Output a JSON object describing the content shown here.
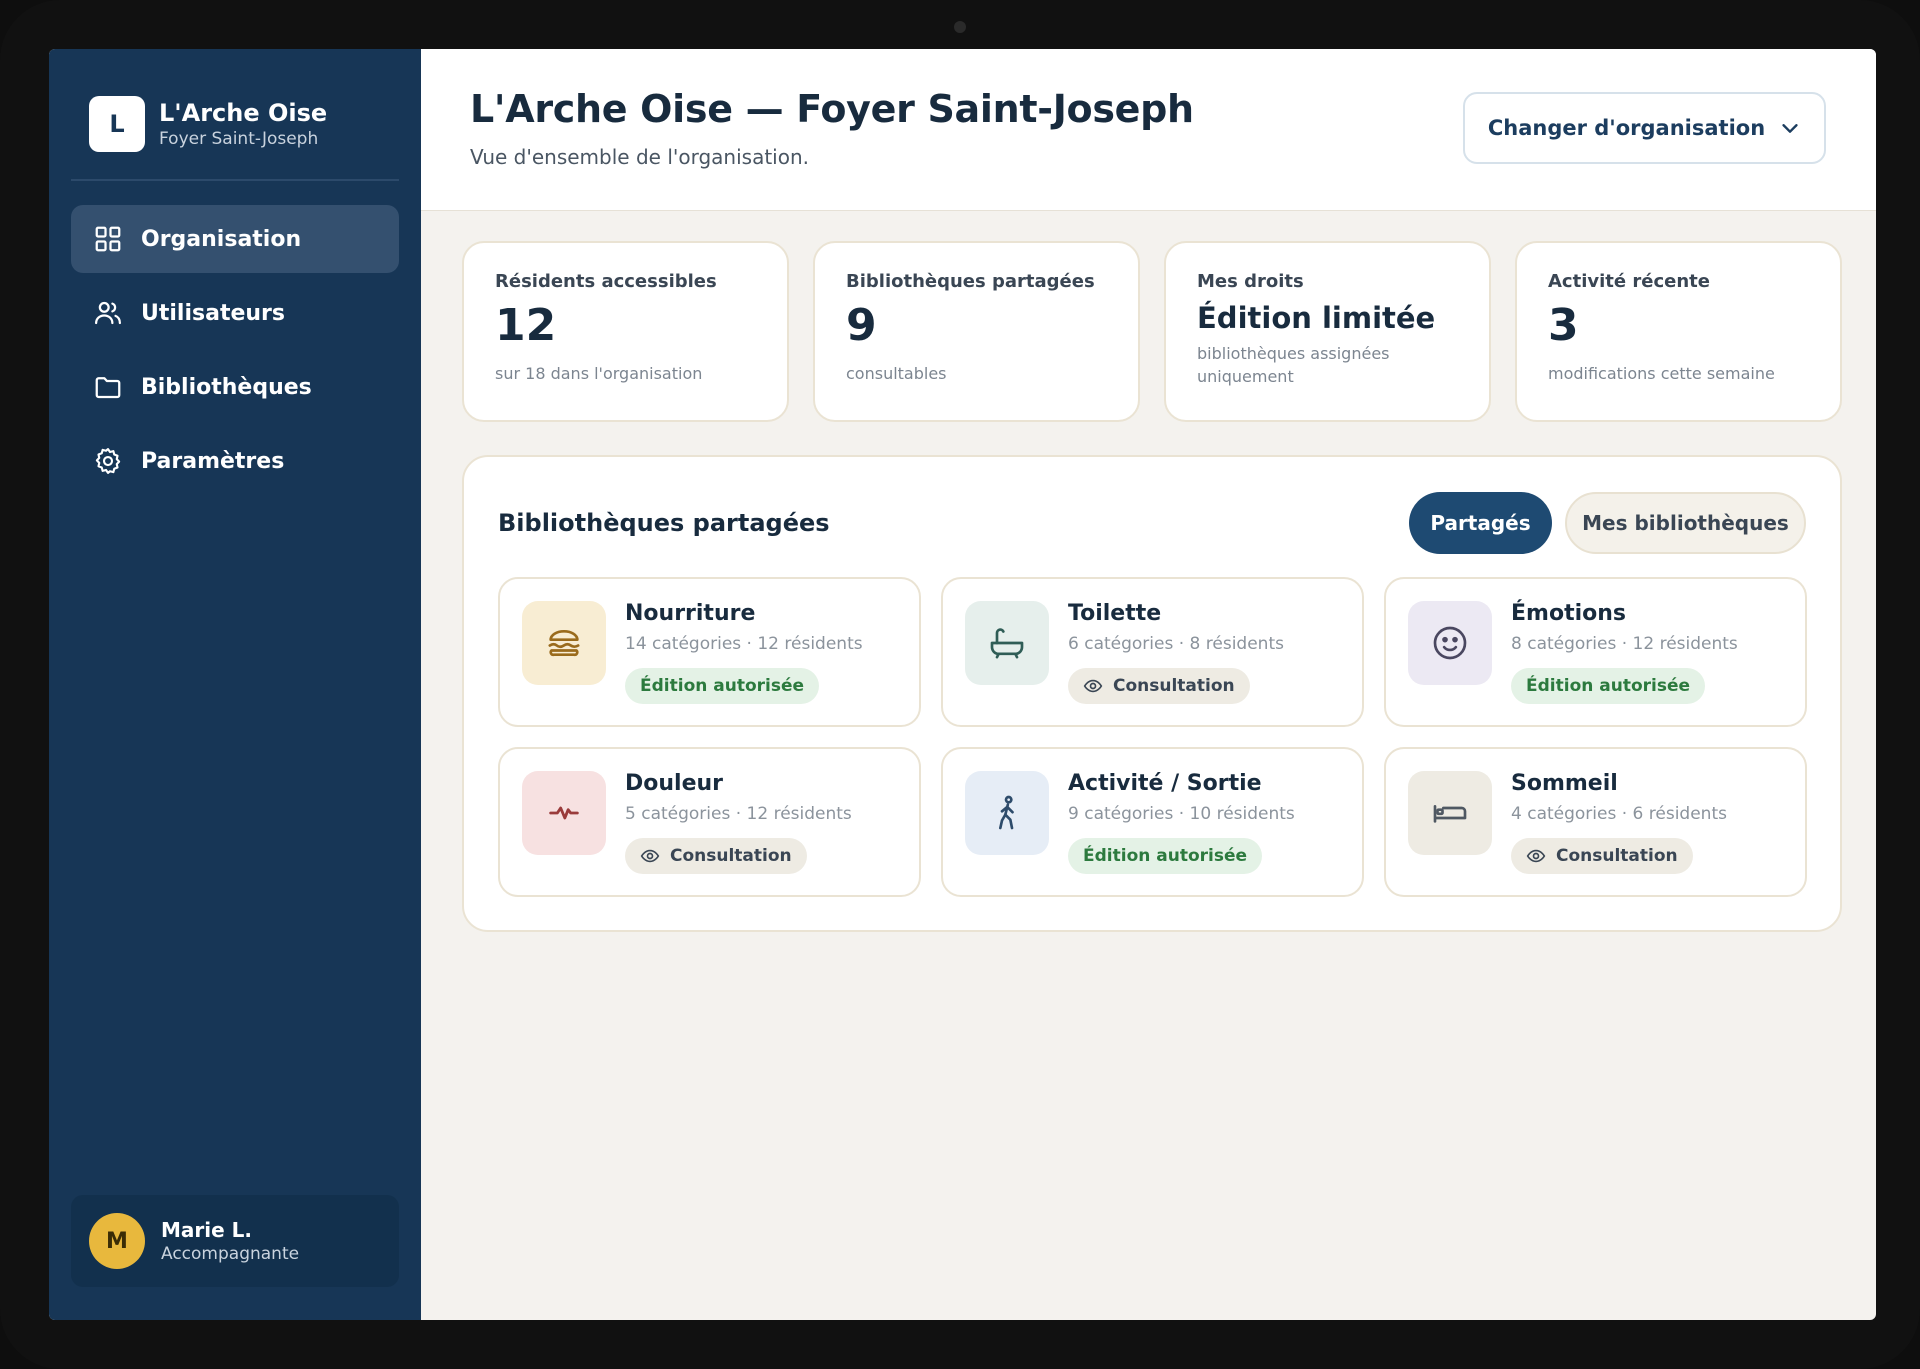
{
  "sidebar": {
    "brand": {
      "initial": "L",
      "title": "L'Arche Oise",
      "subtitle": "Foyer Saint-Joseph"
    },
    "nav": [
      {
        "label": "Organisation",
        "icon": "grid-icon",
        "active": true
      },
      {
        "label": "Utilisateurs",
        "icon": "users-icon",
        "active": false
      },
      {
        "label": "Bibliothèques",
        "icon": "folder-icon",
        "active": false
      },
      {
        "label": "Paramètres",
        "icon": "gear-icon",
        "active": false
      }
    ],
    "user": {
      "initial": "M",
      "name": "Marie L.",
      "role": "Accompagnante"
    }
  },
  "header": {
    "title": "L'Arche Oise — Foyer Saint-Joseph",
    "subtitle": "Vue d'ensemble de l'organisation.",
    "switch_label": "Changer d'organisation"
  },
  "stats": [
    {
      "label": "Résidents accessibles",
      "value": "12",
      "hint": "sur 18 dans l'organisation"
    },
    {
      "label": "Bibliothèques partagées",
      "value": "9",
      "hint": "consultables"
    },
    {
      "label": "Mes droits",
      "value": "Édition limitée",
      "hint": "bibliothèques assignées uniquement"
    },
    {
      "label": "Activité récente",
      "value": "3",
      "hint": "modifications cette semaine"
    }
  ],
  "libraries_panel": {
    "title": "Bibliothèques partagées",
    "tabs": [
      {
        "label": "Partagés",
        "active": true
      },
      {
        "label": "Mes bibliothèques",
        "active": false
      }
    ],
    "items": [
      {
        "name": "Nourriture",
        "meta": "14 catégories · 12 résidents",
        "access": "Édition autorisée",
        "access_type": "edit",
        "icon": "burger-icon",
        "icon_bg": "#f8edd3",
        "icon_color": "#9a6b1c"
      },
      {
        "name": "Toilette",
        "meta": "6 catégories · 8 résidents",
        "access": "Consultation",
        "access_type": "view",
        "icon": "bathtub-icon",
        "icon_bg": "#e6efec",
        "icon_color": "#2f5d56"
      },
      {
        "name": "Émotions",
        "meta": "8 catégories · 12 résidents",
        "access": "Édition autorisée",
        "access_type": "edit",
        "icon": "smiley-icon",
        "icon_bg": "#ece9f3",
        "icon_color": "#4a4760"
      },
      {
        "name": "Douleur",
        "meta": "5 catégories · 12 résidents",
        "access": "Consultation",
        "access_type": "view",
        "icon": "pulse-icon",
        "icon_bg": "#f7e1e1",
        "icon_color": "#9a3b3b"
      },
      {
        "name": "Activité / Sortie",
        "meta": "9 catégories · 10 résidents",
        "access": "Édition autorisée",
        "access_type": "edit",
        "icon": "walking-icon",
        "icon_bg": "#e6edf6",
        "icon_color": "#2e4c6b"
      },
      {
        "name": "Sommeil",
        "meta": "4 catégories · 6 résidents",
        "access": "Consultation",
        "access_type": "view",
        "icon": "bed-icon",
        "icon_bg": "#eeebe3",
        "icon_color": "#4f5862"
      }
    ]
  }
}
